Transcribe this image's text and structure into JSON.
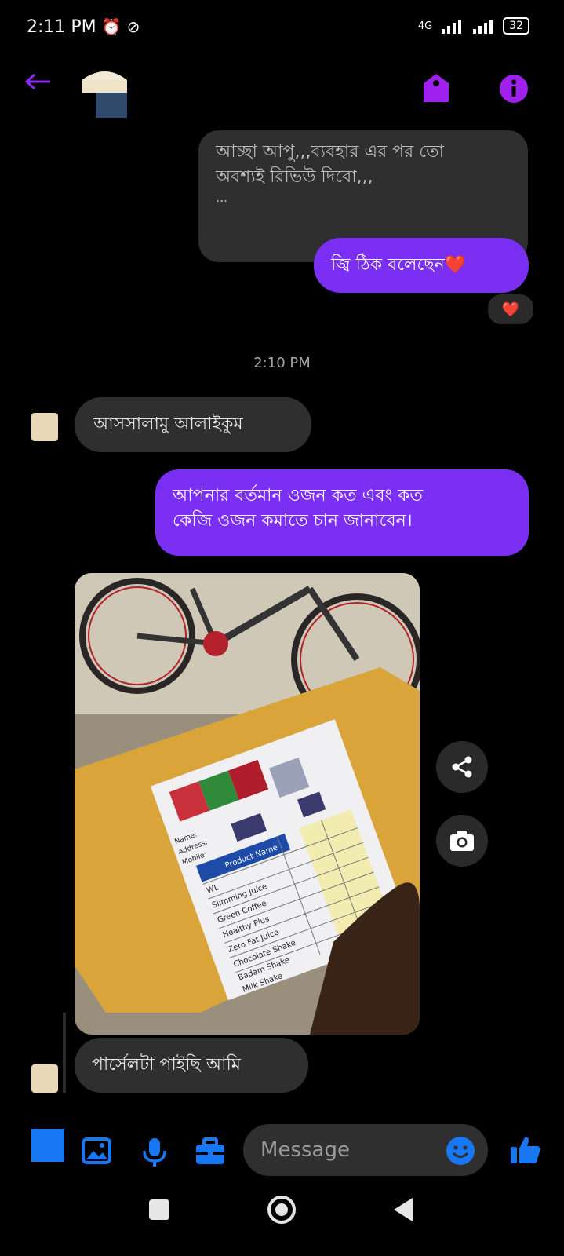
{
  "status_bar": {
    "time": "2:11 PM",
    "network": "4G",
    "battery": "32"
  },
  "colors": {
    "accent": "#7b2ff2",
    "messenger_blue": "#1877f2",
    "gray_bubble": "#2f2f2f"
  },
  "header": {
    "icons": [
      "back-arrow-icon",
      "tag-icon",
      "info-icon"
    ]
  },
  "messages": [
    {
      "side": "received",
      "text_lines": [
        "আচ্ছা আপু,,,ব্যবহার এর পর তো",
        "অবশ্যই রিভিউ দিবো,,,",
        "..."
      ]
    },
    {
      "side": "sent",
      "text": "জ্বি ঠিক বলেছেন❤️",
      "reaction": "❤️"
    },
    {
      "side": "received",
      "text": "আসসালামু আলাইকুম"
    },
    {
      "side": "sent",
      "text_lines": [
        "আপনার বর্তমান ওজন কত এবং কত",
        "কেজি ওজন কমাতে চান জানাবেন।"
      ]
    },
    {
      "side": "received",
      "type": "photo"
    },
    {
      "side": "received",
      "text": "পার্সেলটা পাইছি আমি"
    }
  ],
  "timestamp": "2:10 PM",
  "photo_label": {
    "product_header": "Product Name",
    "products": [
      "Slimming Juice",
      "Green Coffee",
      "Healthy Plus",
      "Zero Fat Juice",
      "Chocolate Shake",
      "Badam Shake",
      "Milk Shake"
    ],
    "fields": [
      "Name:",
      "Address:",
      "Mobile:"
    ],
    "wl": "WL"
  },
  "composer": {
    "placeholder": "Message"
  }
}
